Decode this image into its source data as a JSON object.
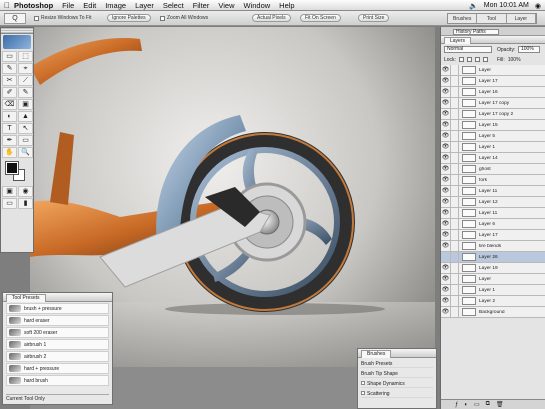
{
  "menubar": {
    "apple": "",
    "items": [
      "Photoshop",
      "File",
      "Edit",
      "Image",
      "Layer",
      "Select",
      "Filter",
      "View",
      "Window",
      "Help"
    ],
    "clock": "Mon 10:01 AM"
  },
  "options": {
    "tool": "Q",
    "check1": "Resize Windows To Fit",
    "btn1": "Ignore Palettes",
    "check2": "Zoom All Windows",
    "btn2": "Actual Pixels",
    "btn3": "Fit On Screen",
    "btn4": "Print Size",
    "well": [
      "Brushes",
      "Tool",
      "Layer"
    ]
  },
  "tools": {
    "items": [
      "▭",
      "⬚",
      "✎",
      "⌖",
      "✂",
      "⟋",
      "✐",
      "✎",
      "⌫",
      "▣",
      "◐",
      "▲",
      "T",
      "↖",
      "✒",
      "▭",
      "✋",
      "🔍"
    ]
  },
  "tool_presets": {
    "title": "Tool Presets",
    "items": [
      "brush + pressure",
      "hard eraser",
      "soft 200 eraser",
      "airbrush 1",
      "airbrush 2",
      "hard + pressure",
      "hard brush"
    ],
    "footer": "Current Tool Only"
  },
  "brushes": {
    "title": "Brushes",
    "items": [
      "Brush Presets",
      "Brush Tip Shape",
      "Shape Dynamics",
      "Scattering"
    ]
  },
  "layers": {
    "top_dropdown": "History  Paths",
    "tab": "Layers",
    "blend": "Normal",
    "opacity_label": "Opacity:",
    "opacity": "100%",
    "lock_label": "Lock:",
    "fill_label": "Fill:",
    "fill": "100%",
    "items": [
      {
        "name": "Layer",
        "eye": "👁",
        "sel": false
      },
      {
        "name": "Layer 17",
        "eye": "👁",
        "sel": false
      },
      {
        "name": "Layer 16",
        "eye": "👁",
        "sel": false
      },
      {
        "name": "Layer 17 copy",
        "eye": "👁",
        "sel": false
      },
      {
        "name": "Layer 17 copy 2",
        "eye": "👁",
        "sel": false
      },
      {
        "name": "Layer 15",
        "eye": "👁",
        "sel": false
      },
      {
        "name": "Layer 5",
        "eye": "👁",
        "sel": false
      },
      {
        "name": "Layer 1",
        "eye": "👁",
        "sel": false
      },
      {
        "name": "Layer 14",
        "eye": "👁",
        "sel": false
      },
      {
        "name": "ghost",
        "eye": "👁",
        "sel": false
      },
      {
        "name": "fork",
        "eye": "👁",
        "sel": false
      },
      {
        "name": "Layer 11",
        "eye": "👁",
        "sel": false
      },
      {
        "name": "Layer 12",
        "eye": "👁",
        "sel": false
      },
      {
        "name": "Layer 11",
        "eye": "👁",
        "sel": false
      },
      {
        "name": "Layer 6",
        "eye": "👁",
        "sel": false
      },
      {
        "name": "Layer 17",
        "eye": "👁",
        "sel": false
      },
      {
        "name": "tire blends",
        "eye": "👁",
        "sel": false
      },
      {
        "name": "Layer 26",
        "eye": "",
        "sel": true
      },
      {
        "name": "Layer 19",
        "eye": "👁",
        "sel": false
      },
      {
        "name": "Layer",
        "eye": "👁",
        "sel": false
      },
      {
        "name": "Layer 1",
        "eye": "👁",
        "sel": false
      },
      {
        "name": "Layer 2",
        "eye": "👁",
        "sel": false
      },
      {
        "name": "Background",
        "eye": "👁",
        "sel": false
      }
    ],
    "bottom_icons": [
      "ƒ",
      "◐",
      "▭",
      "⧉",
      "🗑"
    ]
  }
}
